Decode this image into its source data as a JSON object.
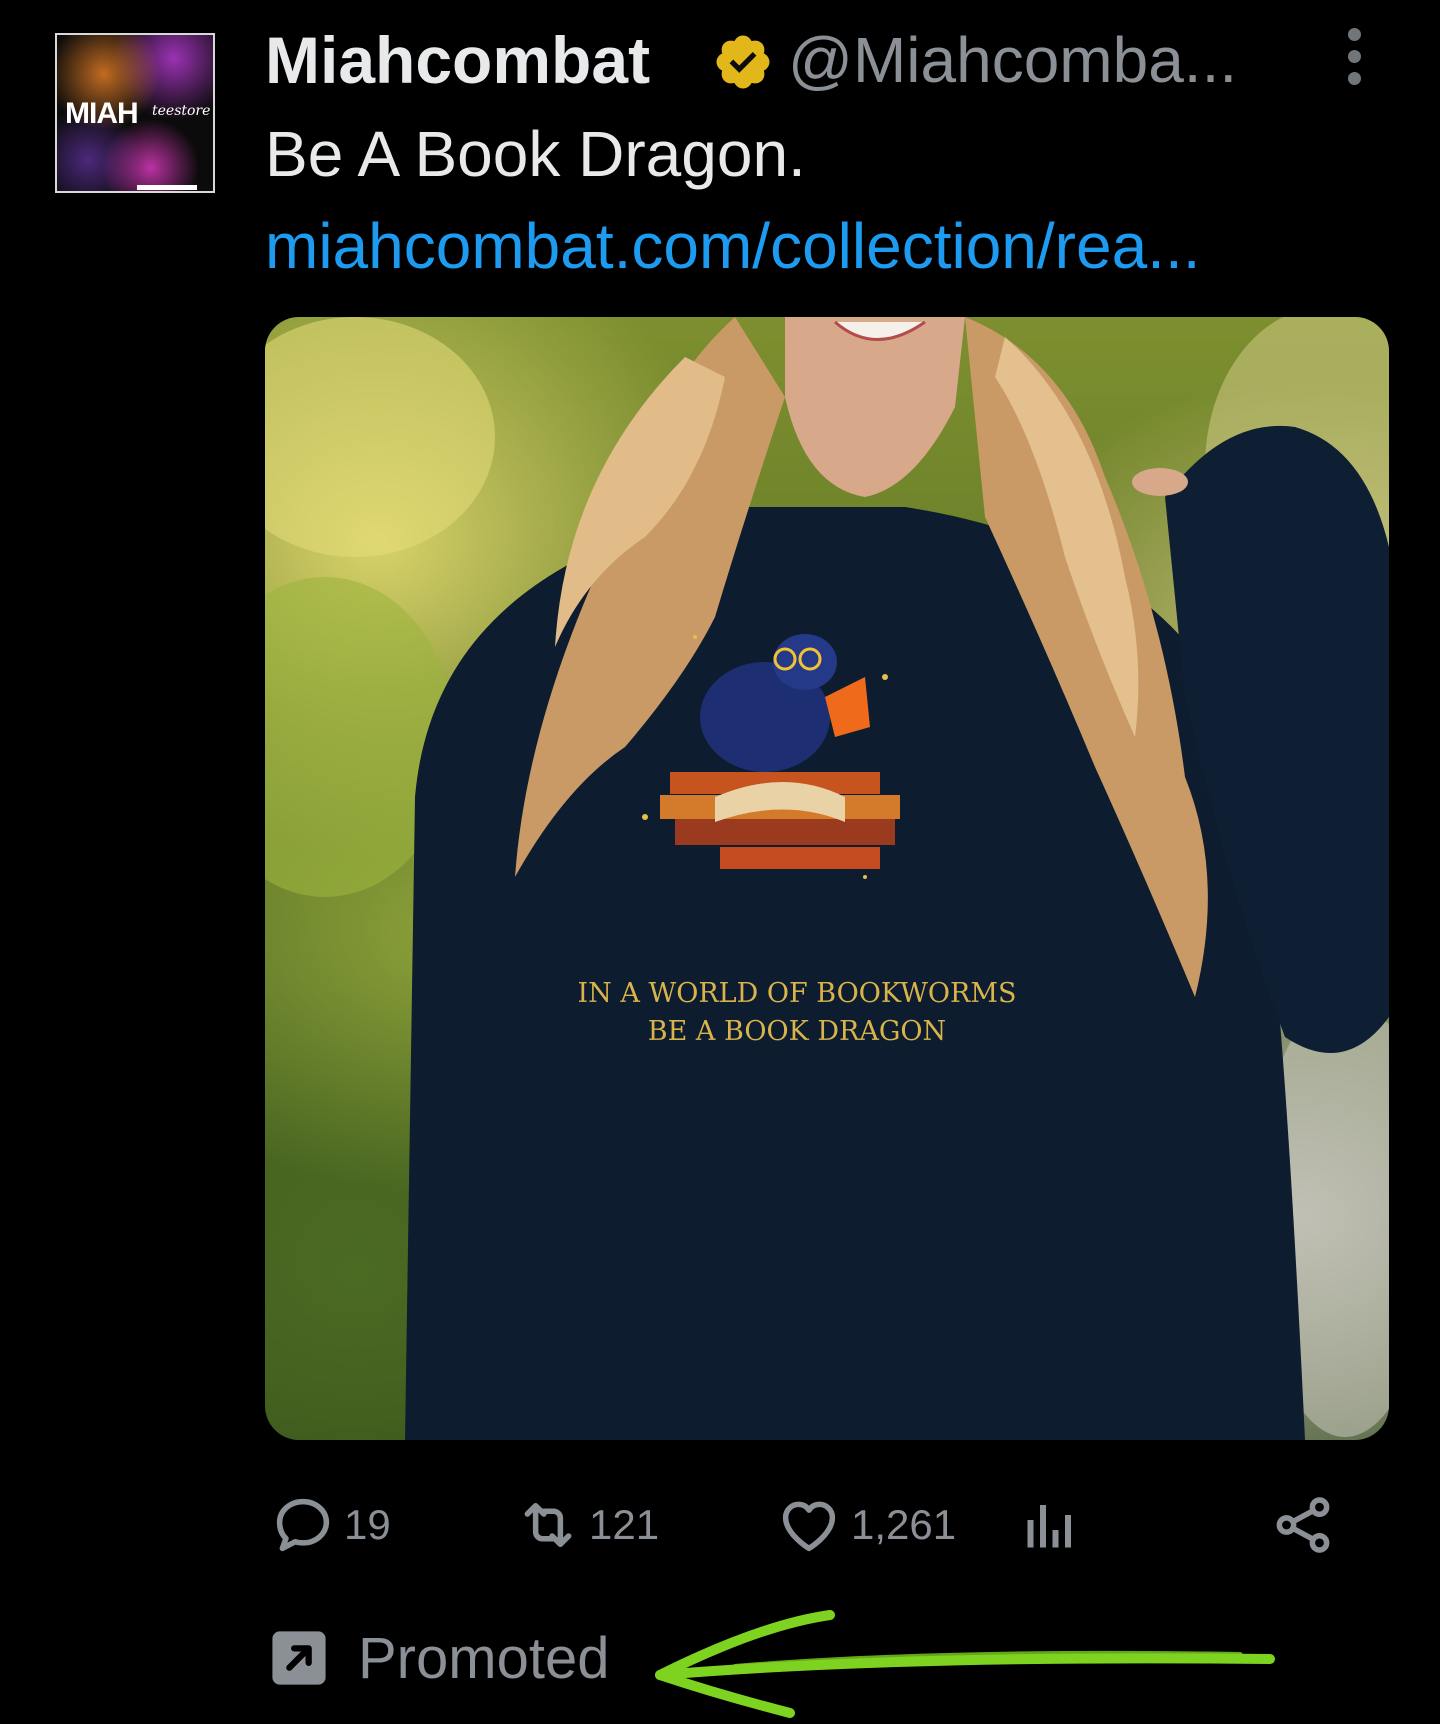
{
  "tweet": {
    "avatar": {
      "logo_main": "MIAH",
      "logo_script": "teestore"
    },
    "display_name": "Miahcombat",
    "handle": "@Miahcomba...",
    "text": "Be A Book Dragon.",
    "link": "miahcombat.com/collection/rea...",
    "media": {
      "shirt_line1": "IN A WORLD OF BOOKWORMS",
      "shirt_line2": "BE A BOOK DRAGON"
    },
    "actions": {
      "replies": "19",
      "retweets": "121",
      "likes": "1,261"
    },
    "promoted_label": "Promoted"
  },
  "colors": {
    "background": "#000000",
    "text": "#e7e9ea",
    "secondary": "#8b9096",
    "link": "#1d9bf0",
    "verified_badge": "#e2b719",
    "annotation": "#7ed321"
  },
  "icons": {
    "verified": "verified-badge-icon",
    "more": "more-vertical-icon",
    "reply": "reply-icon",
    "retweet": "retweet-icon",
    "like": "heart-icon",
    "views": "analytics-icon",
    "share": "share-icon",
    "promoted": "promoted-arrow-icon"
  }
}
